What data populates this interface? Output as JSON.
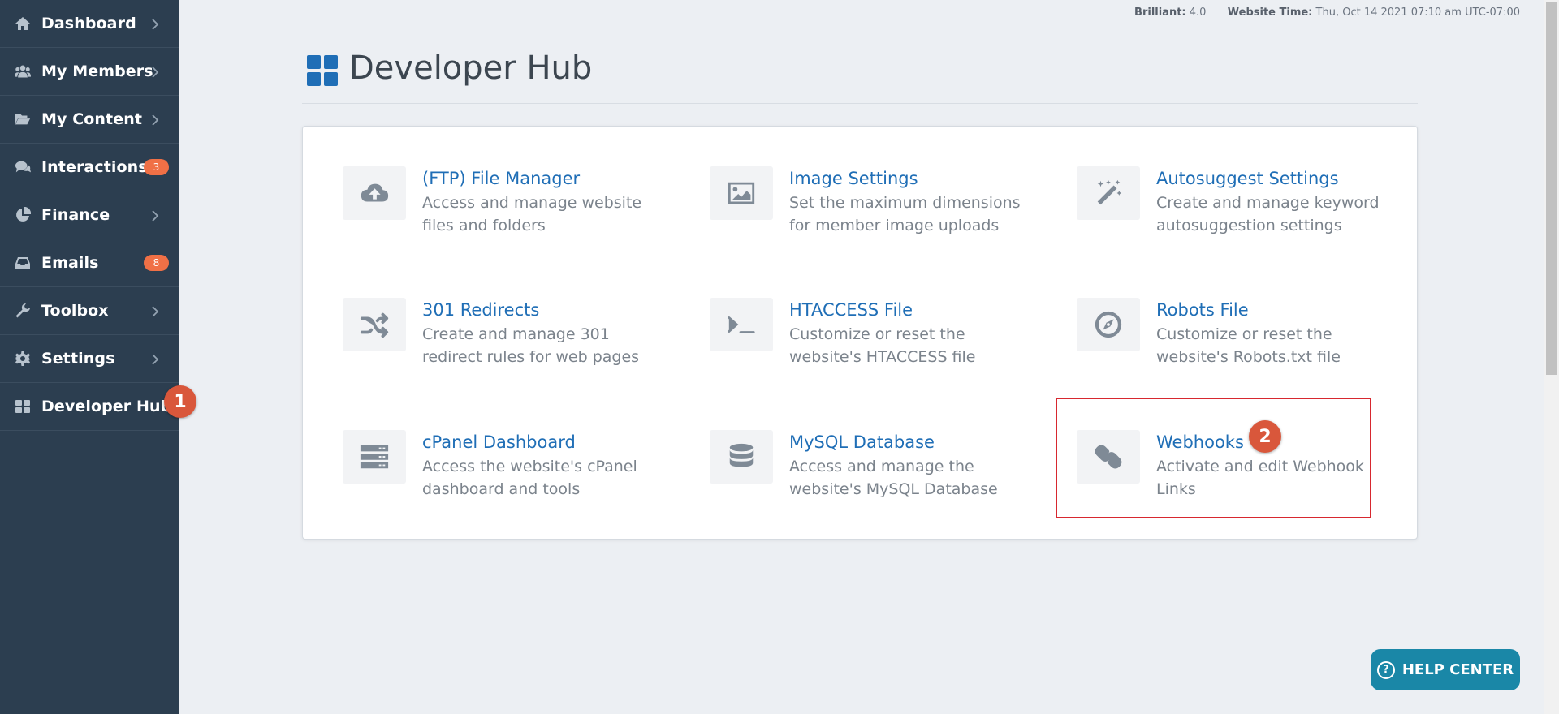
{
  "sidebar": {
    "items": [
      {
        "label": "Dashboard",
        "icon": "home-icon"
      },
      {
        "label": "My Members",
        "icon": "users-icon"
      },
      {
        "label": "My Content",
        "icon": "folder-open-icon"
      },
      {
        "label": "Interactions",
        "icon": "comments-icon",
        "badge": "3"
      },
      {
        "label": "Finance",
        "icon": "pie-chart-icon"
      },
      {
        "label": "Emails",
        "icon": "inbox-icon",
        "badge": "8"
      },
      {
        "label": "Toolbox",
        "icon": "wrench-icon"
      },
      {
        "label": "Settings",
        "icon": "gear-icon"
      },
      {
        "label": "Developer Hub",
        "icon": "grid-icon"
      }
    ]
  },
  "markers": {
    "step1": "1",
    "step2": "2"
  },
  "topmeta": {
    "brilliant_label": "Brilliant:",
    "brilliant_value": "4.0",
    "time_label": "Website Time:",
    "time_value": "Thu, Oct 14 2021 07:10 am UTC-07:00"
  },
  "page": {
    "title": "Developer Hub"
  },
  "tools": [
    {
      "title": "(FTP) File Manager",
      "desc": "Access and manage website files and folders",
      "icon": "cloud-upload-icon"
    },
    {
      "title": "Image Settings",
      "desc": "Set the maximum dimensions for member image uploads",
      "icon": "image-icon"
    },
    {
      "title": "Autosuggest Settings",
      "desc": "Create and manage keyword autosuggestion settings",
      "icon": "magic-wand-icon"
    },
    {
      "title": "301 Redirects",
      "desc": "Create and manage 301 redirect rules for web pages",
      "icon": "shuffle-icon"
    },
    {
      "title": "HTACCESS File",
      "desc": "Customize or reset the website's HTACCESS file",
      "icon": "terminal-icon"
    },
    {
      "title": "Robots File",
      "desc": "Customize or reset the website's Robots.txt file",
      "icon": "compass-icon"
    },
    {
      "title": "cPanel Dashboard",
      "desc": "Access the website's cPanel dashboard and tools",
      "icon": "server-icon"
    },
    {
      "title": "MySQL Database",
      "desc": "Access and manage the website's MySQL Database",
      "icon": "database-icon"
    },
    {
      "title": "Webhooks",
      "desc": "Activate and edit Webhook Links",
      "icon": "link-icon"
    }
  ],
  "help": {
    "label": "HELP CENTER"
  },
  "colors": {
    "sidebar": "#2c3e50",
    "link": "#1f6eb6",
    "badge": "#f07046",
    "marker": "#d9573b",
    "highlight": "#d7282f",
    "help": "#1a87a7"
  }
}
